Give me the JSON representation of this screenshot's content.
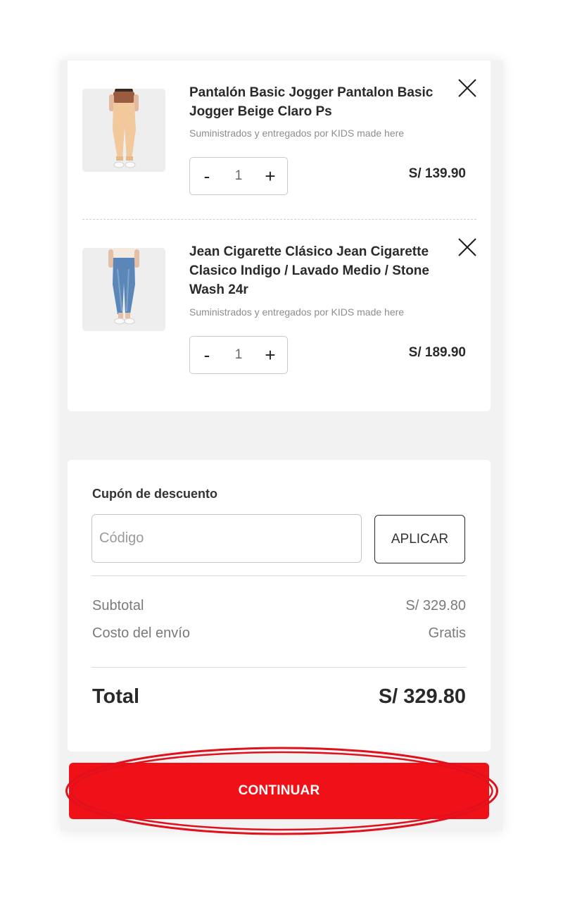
{
  "cart": {
    "items": [
      {
        "title": "Pantalón Basic Jogger Pantalon Basic Jogger Beige Claro Ps",
        "seller": "Suministrados y entregados por KIDS made here",
        "quantity": "1",
        "price": "S/ 139.90",
        "minus_label": "-",
        "plus_label": "+",
        "image_icon": "beige-jogger-pants",
        "garment_color": "#f2c99d"
      },
      {
        "title": "Jean Cigarette Clásico Jean Cigarette Clasico Indigo / Lavado Medio / Stone Wash 24r",
        "seller": "Suministrados y entregados por KIDS made here",
        "quantity": "1",
        "price": "S/ 189.90",
        "minus_label": "-",
        "plus_label": "+",
        "image_icon": "blue-jeans",
        "garment_color": "#5b87b8"
      }
    ]
  },
  "coupon": {
    "label": "Cupón de descuento",
    "placeholder": "Código",
    "value": "",
    "apply_label": "APLICAR"
  },
  "summary": {
    "subtotal_label": "Subtotal",
    "subtotal_value": "S/ 329.80",
    "shipping_label": "Costo del envío",
    "shipping_value": "Gratis",
    "total_label": "Total",
    "total_value": "S/ 329.80"
  },
  "actions": {
    "continue_label": "CONTINUAR"
  },
  "colors": {
    "accent": "#f01018",
    "page_background": "#f3f2f2",
    "highlight_ring": "#e0101c"
  }
}
